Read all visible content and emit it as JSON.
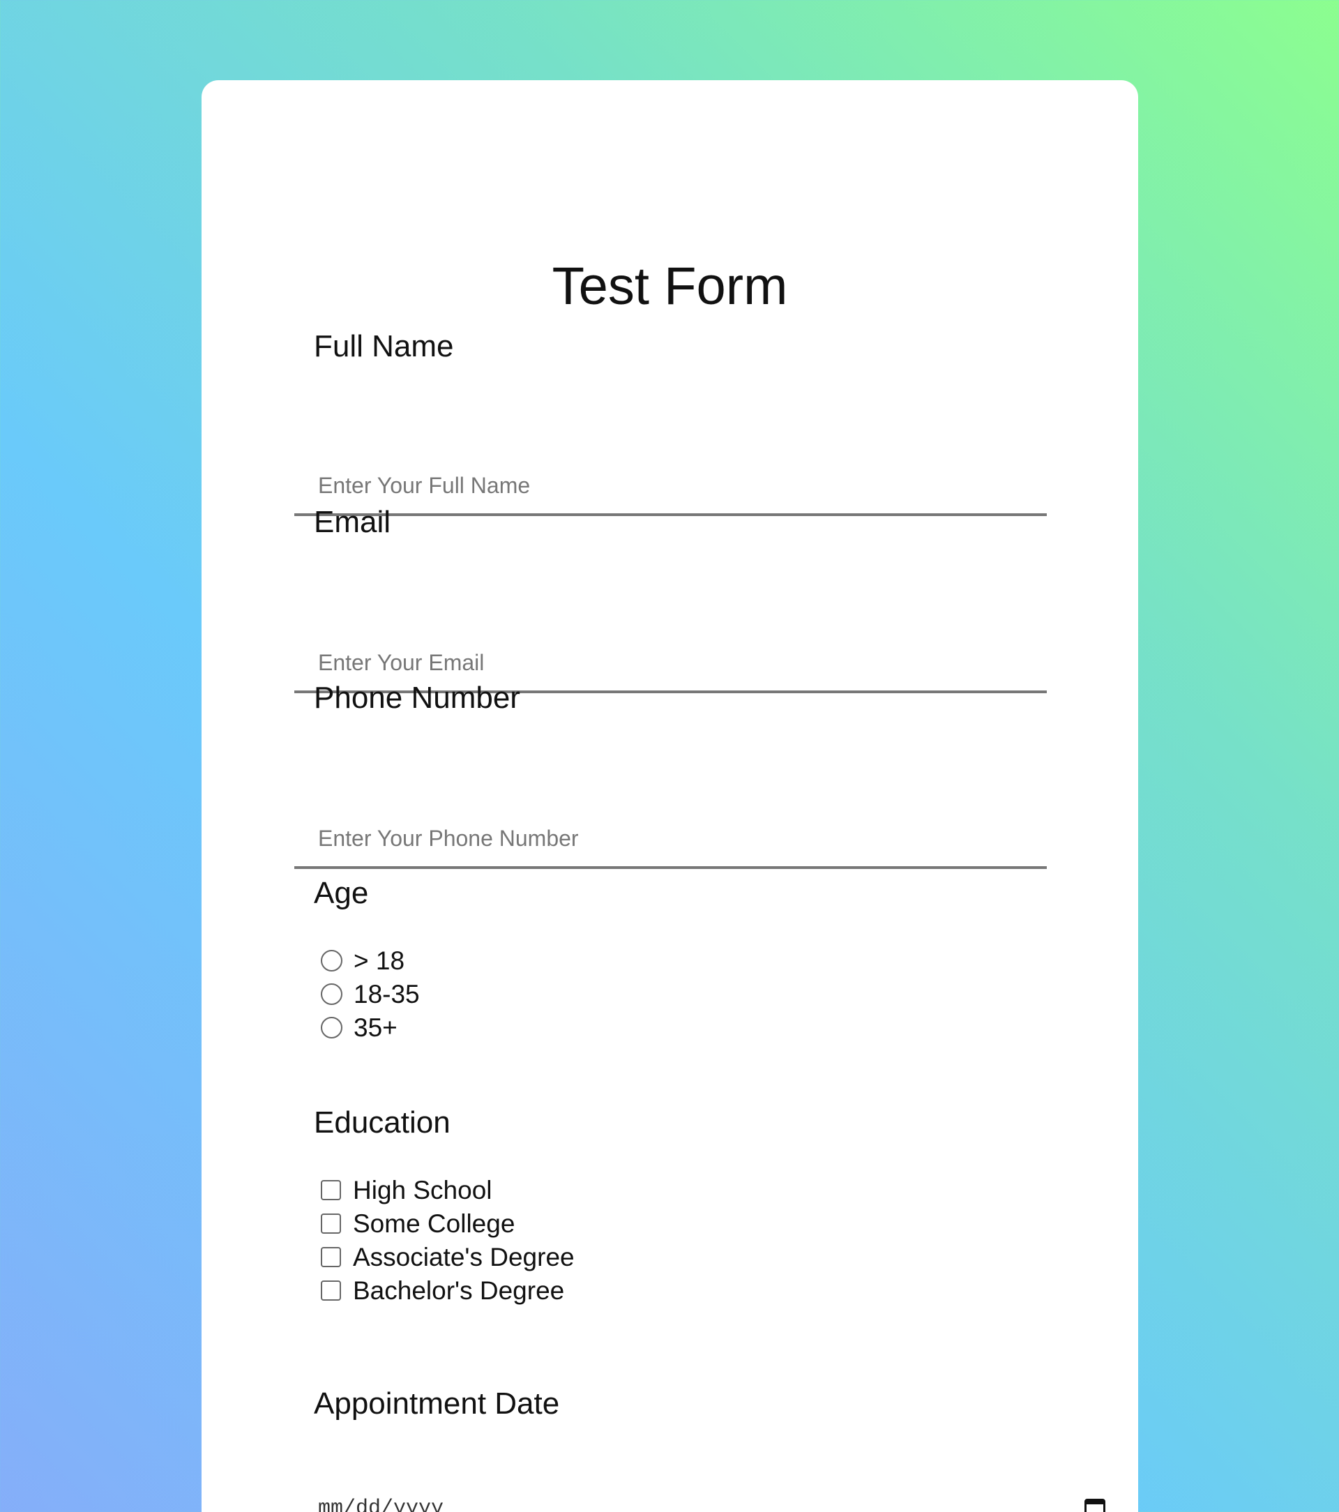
{
  "form": {
    "title": "Test Form",
    "full_name": {
      "label": "Full Name",
      "placeholder": "Enter Your Full Name"
    },
    "email": {
      "label": "Email",
      "placeholder": "Enter Your Email"
    },
    "phone": {
      "label": "Phone Number",
      "placeholder": "Enter Your Phone Number"
    },
    "age": {
      "label": "Age",
      "options": [
        "> 18",
        "18-35",
        "35+"
      ]
    },
    "education": {
      "label": "Education",
      "options": [
        "High School",
        "Some College",
        "Associate's Degree",
        "Bachelor's Degree"
      ]
    },
    "appointment": {
      "label": "Appointment Date",
      "placeholder": "mm/dd/yyyy",
      "icon": "calendar-icon"
    }
  },
  "colors": {
    "gradient_start": "#85aef9",
    "gradient_mid": "#6acafa",
    "gradient_end": "#8cfe8f",
    "card": "#ffffff",
    "underline": "#777777"
  }
}
